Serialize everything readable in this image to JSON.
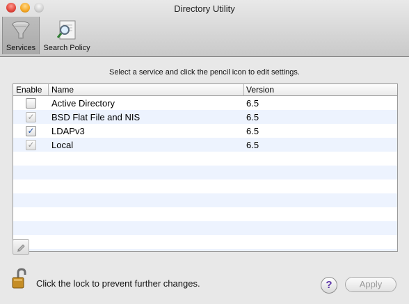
{
  "window": {
    "title": "Directory Utility"
  },
  "toolbar": {
    "items": [
      {
        "label": "Services",
        "icon": "services-icon",
        "selected": true
      },
      {
        "label": "Search Policy",
        "icon": "search-policy-icon",
        "selected": false
      }
    ]
  },
  "services": {
    "instruction": "Select a service and click the pencil icon to edit settings.",
    "columns": {
      "enable": "Enable",
      "name": "Name",
      "version": "Version"
    },
    "rows": [
      {
        "name": "Active Directory",
        "version": "6.5",
        "enabled": false,
        "state": "unchecked"
      },
      {
        "name": "BSD Flat File and NIS",
        "version": "6.5",
        "enabled": true,
        "state": "checked-dim"
      },
      {
        "name": "LDAPv3",
        "version": "6.5",
        "enabled": true,
        "state": "checked"
      },
      {
        "name": "Local",
        "version": "6.5",
        "enabled": true,
        "state": "checked-dim"
      }
    ],
    "edit_icon": "pencil-icon"
  },
  "footer": {
    "lock_text": "Click the lock to prevent further changes.",
    "lock_icon": "lock-open-icon",
    "help_symbol": "?",
    "apply_label": "Apply",
    "apply_enabled": false
  }
}
